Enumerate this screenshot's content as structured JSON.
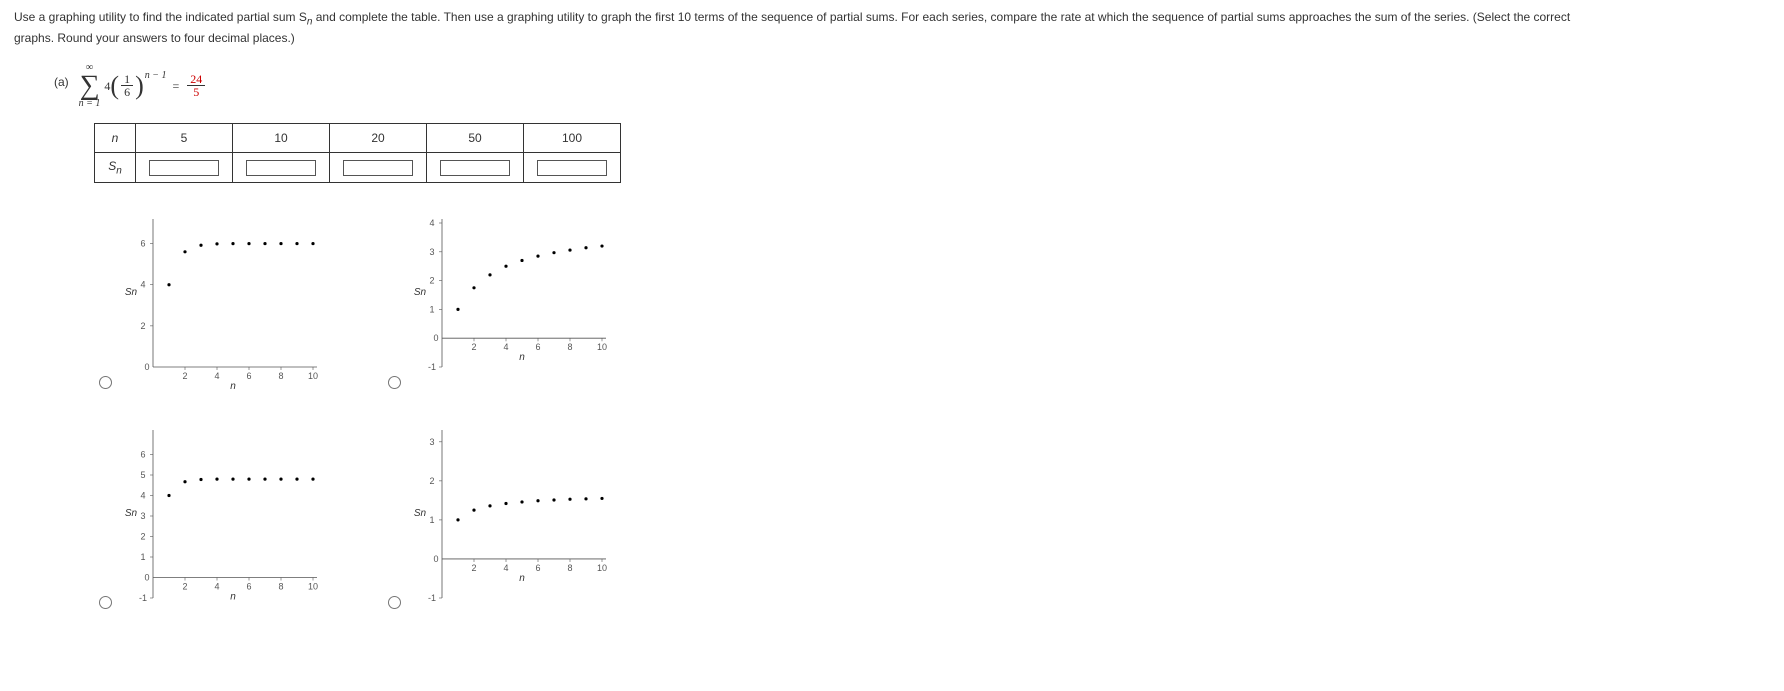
{
  "instructions": {
    "line1": "Use a graphing utility to find the indicated partial sum S",
    "line1b": " and complete the table. Then use a graphing utility to graph the first 10 terms of the sequence of partial sums. For each series, compare the rate at which the sequence of partial sums approaches the sum of the series. (Select the correct",
    "line2": "graphs. Round your answers to four decimal places.)"
  },
  "problem": {
    "label": "(a)",
    "sigma_upper": "∞",
    "sigma_lower": "n = 1",
    "coef": "4",
    "inner_num": "1",
    "inner_den": "6",
    "exp": "n − 1",
    "eq": "=",
    "rhs_num": "24",
    "rhs_den": "5"
  },
  "table": {
    "row_header_n": "n",
    "row_header_sn": "S",
    "cols": [
      "5",
      "10",
      "20",
      "50",
      "100"
    ],
    "values": [
      "",
      "",
      "",
      "",
      ""
    ]
  },
  "axis": {
    "x_label": "n",
    "y_label": "Sn"
  },
  "chart_data": [
    {
      "type": "scatter",
      "title": "",
      "xlabel": "n",
      "ylabel": "Sn",
      "xlim": [
        0,
        10
      ],
      "ylim": [
        0,
        7
      ],
      "y_ticks": [
        2,
        4,
        6
      ],
      "x_ticks": [
        2,
        4,
        6,
        8,
        10
      ],
      "points": [
        {
          "x": 1,
          "y": 4.0
        },
        {
          "x": 2,
          "y": 5.6
        },
        {
          "x": 3,
          "y": 5.92
        },
        {
          "x": 4,
          "y": 5.984
        },
        {
          "x": 5,
          "y": 5.9968
        },
        {
          "x": 6,
          "y": 5.999
        },
        {
          "x": 7,
          "y": 6.0
        },
        {
          "x": 8,
          "y": 6.0
        },
        {
          "x": 9,
          "y": 6.0
        },
        {
          "x": 10,
          "y": 6.0
        }
      ]
    },
    {
      "type": "scatter",
      "title": "",
      "xlabel": "n",
      "ylabel": "Sn",
      "xlim": [
        0,
        10
      ],
      "ylim": [
        -1,
        4
      ],
      "y_ticks": [
        -1,
        1,
        2,
        3,
        4
      ],
      "x_ticks": [
        2,
        4,
        6,
        8,
        10
      ],
      "points": [
        {
          "x": 1,
          "y": 1.0
        },
        {
          "x": 2,
          "y": 1.75
        },
        {
          "x": 3,
          "y": 2.2
        },
        {
          "x": 4,
          "y": 2.5
        },
        {
          "x": 5,
          "y": 2.7
        },
        {
          "x": 6,
          "y": 2.85
        },
        {
          "x": 7,
          "y": 2.97
        },
        {
          "x": 8,
          "y": 3.06
        },
        {
          "x": 9,
          "y": 3.14
        },
        {
          "x": 10,
          "y": 3.2
        }
      ]
    },
    {
      "type": "scatter",
      "title": "",
      "xlabel": "n",
      "ylabel": "Sn",
      "xlim": [
        0,
        10
      ],
      "ylim": [
        -1,
        7
      ],
      "y_ticks": [
        -1,
        1,
        2,
        3,
        4,
        5,
        6
      ],
      "x_ticks": [
        2,
        4,
        6,
        8,
        10
      ],
      "points": [
        {
          "x": 1,
          "y": 4.0
        },
        {
          "x": 2,
          "y": 4.67
        },
        {
          "x": 3,
          "y": 4.78
        },
        {
          "x": 4,
          "y": 4.8
        },
        {
          "x": 5,
          "y": 4.8
        },
        {
          "x": 6,
          "y": 4.8
        },
        {
          "x": 7,
          "y": 4.8
        },
        {
          "x": 8,
          "y": 4.8
        },
        {
          "x": 9,
          "y": 4.8
        },
        {
          "x": 10,
          "y": 4.8
        }
      ]
    },
    {
      "type": "scatter",
      "title": "",
      "xlabel": "n",
      "ylabel": "Sn",
      "xlim": [
        0,
        10
      ],
      "ylim": [
        -1,
        3.2
      ],
      "y_ticks": [
        -1,
        1,
        2,
        3
      ],
      "x_ticks": [
        2,
        4,
        6,
        8,
        10
      ],
      "points": [
        {
          "x": 1,
          "y": 1.0
        },
        {
          "x": 2,
          "y": 1.25
        },
        {
          "x": 3,
          "y": 1.36
        },
        {
          "x": 4,
          "y": 1.42
        },
        {
          "x": 5,
          "y": 1.46
        },
        {
          "x": 6,
          "y": 1.49
        },
        {
          "x": 7,
          "y": 1.51
        },
        {
          "x": 8,
          "y": 1.53
        },
        {
          "x": 9,
          "y": 1.54
        },
        {
          "x": 10,
          "y": 1.55
        }
      ]
    }
  ]
}
